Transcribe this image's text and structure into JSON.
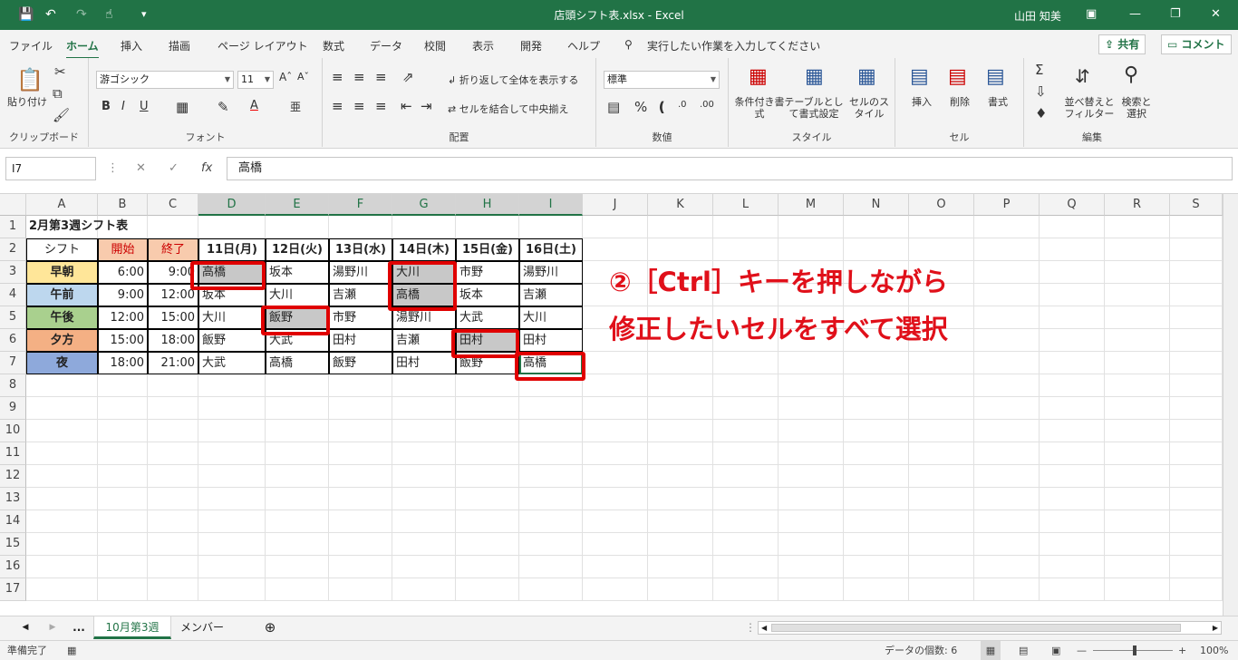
{
  "titlebar": {
    "title": "店頭シフト表.xlsx  -  Excel",
    "user": "山田 知美"
  },
  "menubar": {
    "tabs": [
      "ファイル",
      "ホーム",
      "挿入",
      "描画",
      "ページ レイアウト",
      "数式",
      "データ",
      "校閲",
      "表示",
      "開発",
      "ヘルプ"
    ],
    "search_text": "実行したい作業を入力してください",
    "share_label": "共有",
    "comment_label": "コメント"
  },
  "ribbon": {
    "clipboard": {
      "paste_label": "貼り付け",
      "group_label": "クリップボード"
    },
    "font": {
      "font_name": "游ゴシック",
      "font_size": "11",
      "group_label": "フォント"
    },
    "alignment": {
      "wrap_label": "折り返して全体を表示する",
      "merge_label": "セルを結合して中央揃え",
      "group_label": "配置"
    },
    "number": {
      "format": "標準",
      "group_label": "数値"
    },
    "styles": {
      "cond_label": "条件付き書式",
      "table_label": "テーブルとして書式設定",
      "cellstyle_label": "セルのスタイル",
      "group_label": "スタイル"
    },
    "cells": {
      "insert_label": "挿入",
      "delete_label": "削除",
      "format_label": "書式",
      "group_label": "セル"
    },
    "editing": {
      "sort_label": "並べ替えとフィルター",
      "find_label": "検索と選択",
      "group_label": "編集"
    }
  },
  "formula_bar": {
    "name_box": "I7",
    "content": "高橋"
  },
  "grid": {
    "columns": [
      "A",
      "B",
      "C",
      "D",
      "E",
      "F",
      "G",
      "H",
      "I",
      "J",
      "K",
      "L",
      "M",
      "N",
      "O",
      "P",
      "Q",
      "R",
      "S"
    ],
    "rows": [
      "1",
      "2",
      "3",
      "4",
      "5",
      "6",
      "7",
      "8",
      "9",
      "10",
      "11",
      "12",
      "13",
      "14",
      "15",
      "16",
      "17"
    ]
  },
  "sheet": {
    "title": "2月第3週シフト表",
    "headers": [
      "シフト",
      "開始",
      "終了",
      "11日(月)",
      "12日(火)",
      "13日(水)",
      "14日(木)",
      "15日(金)",
      "16日(土)"
    ],
    "rows": [
      {
        "shift": "早朝",
        "start": "6:00",
        "end": "9:00",
        "days": [
          "高橋",
          "坂本",
          "湯野川",
          "大川",
          "市野",
          "湯野川"
        ]
      },
      {
        "shift": "午前",
        "start": "9:00",
        "end": "12:00",
        "days": [
          "坂本",
          "大川",
          "吉瀬",
          "高橋",
          "坂本",
          "吉瀬"
        ]
      },
      {
        "shift": "午後",
        "start": "12:00",
        "end": "15:00",
        "days": [
          "大川",
          "飯野",
          "市野",
          "湯野川",
          "大武",
          "大川"
        ]
      },
      {
        "shift": "夕方",
        "start": "15:00",
        "end": "18:00",
        "days": [
          "飯野",
          "大武",
          "田村",
          "吉瀬",
          "田村",
          "田村"
        ]
      },
      {
        "shift": "夜",
        "start": "18:00",
        "end": "21:00",
        "days": [
          "大武",
          "高橋",
          "飯野",
          "田村",
          "飯野",
          "高橋"
        ]
      }
    ],
    "shift_colors": [
      "#ffe699",
      "#bdd7ee",
      "#a9d08e",
      "#f4b084",
      "#8ea9db"
    ],
    "time_header_color": "#f8cbad"
  },
  "annotation": {
    "line1": "②［Ctrl］キーを押しながら",
    "line2": "修正したいセルをすべて選択"
  },
  "sheet_tabs": {
    "more": "...",
    "active": "10月第3週",
    "other": "メンバー"
  },
  "statusbar": {
    "ready": "準備完了",
    "count": "データの個数: 6",
    "zoom": "100%"
  }
}
